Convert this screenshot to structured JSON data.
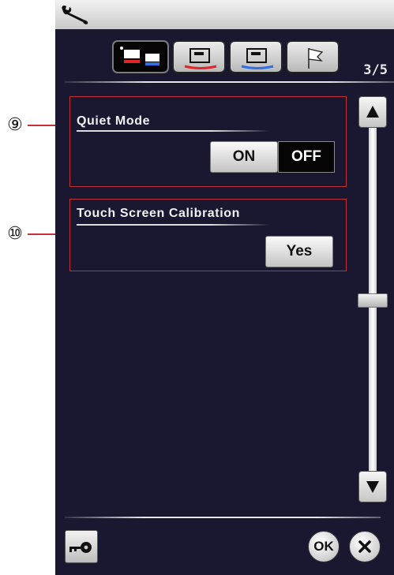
{
  "callouts": [
    {
      "label": "⑨"
    },
    {
      "label": "⑩"
    }
  ],
  "header": {
    "icon": "wrench-icon"
  },
  "tabs": [
    {
      "icon": "machine-settings-icon",
      "active": true
    },
    {
      "icon": "stitch-settings-icon",
      "active": false,
      "accent": "#e0262b"
    },
    {
      "icon": "embroidery-settings-icon",
      "active": false,
      "accent": "#2f6fe0"
    },
    {
      "icon": "language-flag-icon",
      "active": false
    }
  ],
  "page_indicator": "3/5",
  "settings": {
    "quiet_mode": {
      "title": "Quiet Mode",
      "on_label": "ON",
      "off_label": "OFF",
      "selected": "OFF"
    },
    "calibration": {
      "title": "Touch Screen Calibration",
      "button_label": "Yes"
    }
  },
  "scrollbar": {
    "up_icon": "arrow-up-icon",
    "down_icon": "arrow-down-icon",
    "position": 0.5
  },
  "footer": {
    "lock_icon": "key-icon",
    "ok_label": "OK",
    "close_icon": "close-icon"
  },
  "colors": {
    "screen_bg": "#1a1831",
    "section_border": "#c03038",
    "callout_line": "#c9303a"
  }
}
